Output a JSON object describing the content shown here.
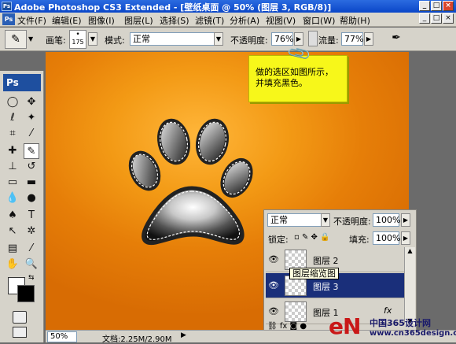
{
  "window": {
    "title": "Adobe Photoshop CS3 Extended - [壁纸桌面 @ 50% (图层 3, RGB/8)]",
    "icon_text": "Ps"
  },
  "menu": [
    "文件(F)",
    "编辑(E)",
    "图像(I)",
    "图层(L)",
    "选择(S)",
    "滤镜(T)",
    "分析(A)",
    "视图(V)",
    "窗口(W)",
    "帮助(H)"
  ],
  "options": {
    "brush_label": "画笔:",
    "brush_size": "175",
    "mode_label": "模式:",
    "mode_value": "正常",
    "opacity_label": "不透明度:",
    "opacity_value": "76%",
    "flow_label": "流量:",
    "flow_value": "77%"
  },
  "toolbox": {
    "header": "Ps"
  },
  "note": {
    "text": "做的选区如图所示，并填充黑色。"
  },
  "layers": {
    "blend_mode": "正常",
    "opacity_label": "不透明度:",
    "opacity_value": "100%",
    "lock_label": "锁定:",
    "fill_label": "填充:",
    "fill_value": "100%",
    "items": [
      {
        "name": "图层 2"
      },
      {
        "name": "图层 3"
      },
      {
        "name": "图层 1"
      }
    ],
    "tooltip": "图层缩览图",
    "fx": "fx"
  },
  "status": {
    "zoom": "50%",
    "doc": "文档:2.25M/2.90M"
  },
  "watermark": {
    "logo": "eN",
    "cn": "中国365设计网",
    "url": "www.cn365design.com"
  },
  "colors": {
    "canvas_orange": "#f39a15",
    "note_yellow": "#f7f71a",
    "selected_layer": "#1a2f7a"
  }
}
